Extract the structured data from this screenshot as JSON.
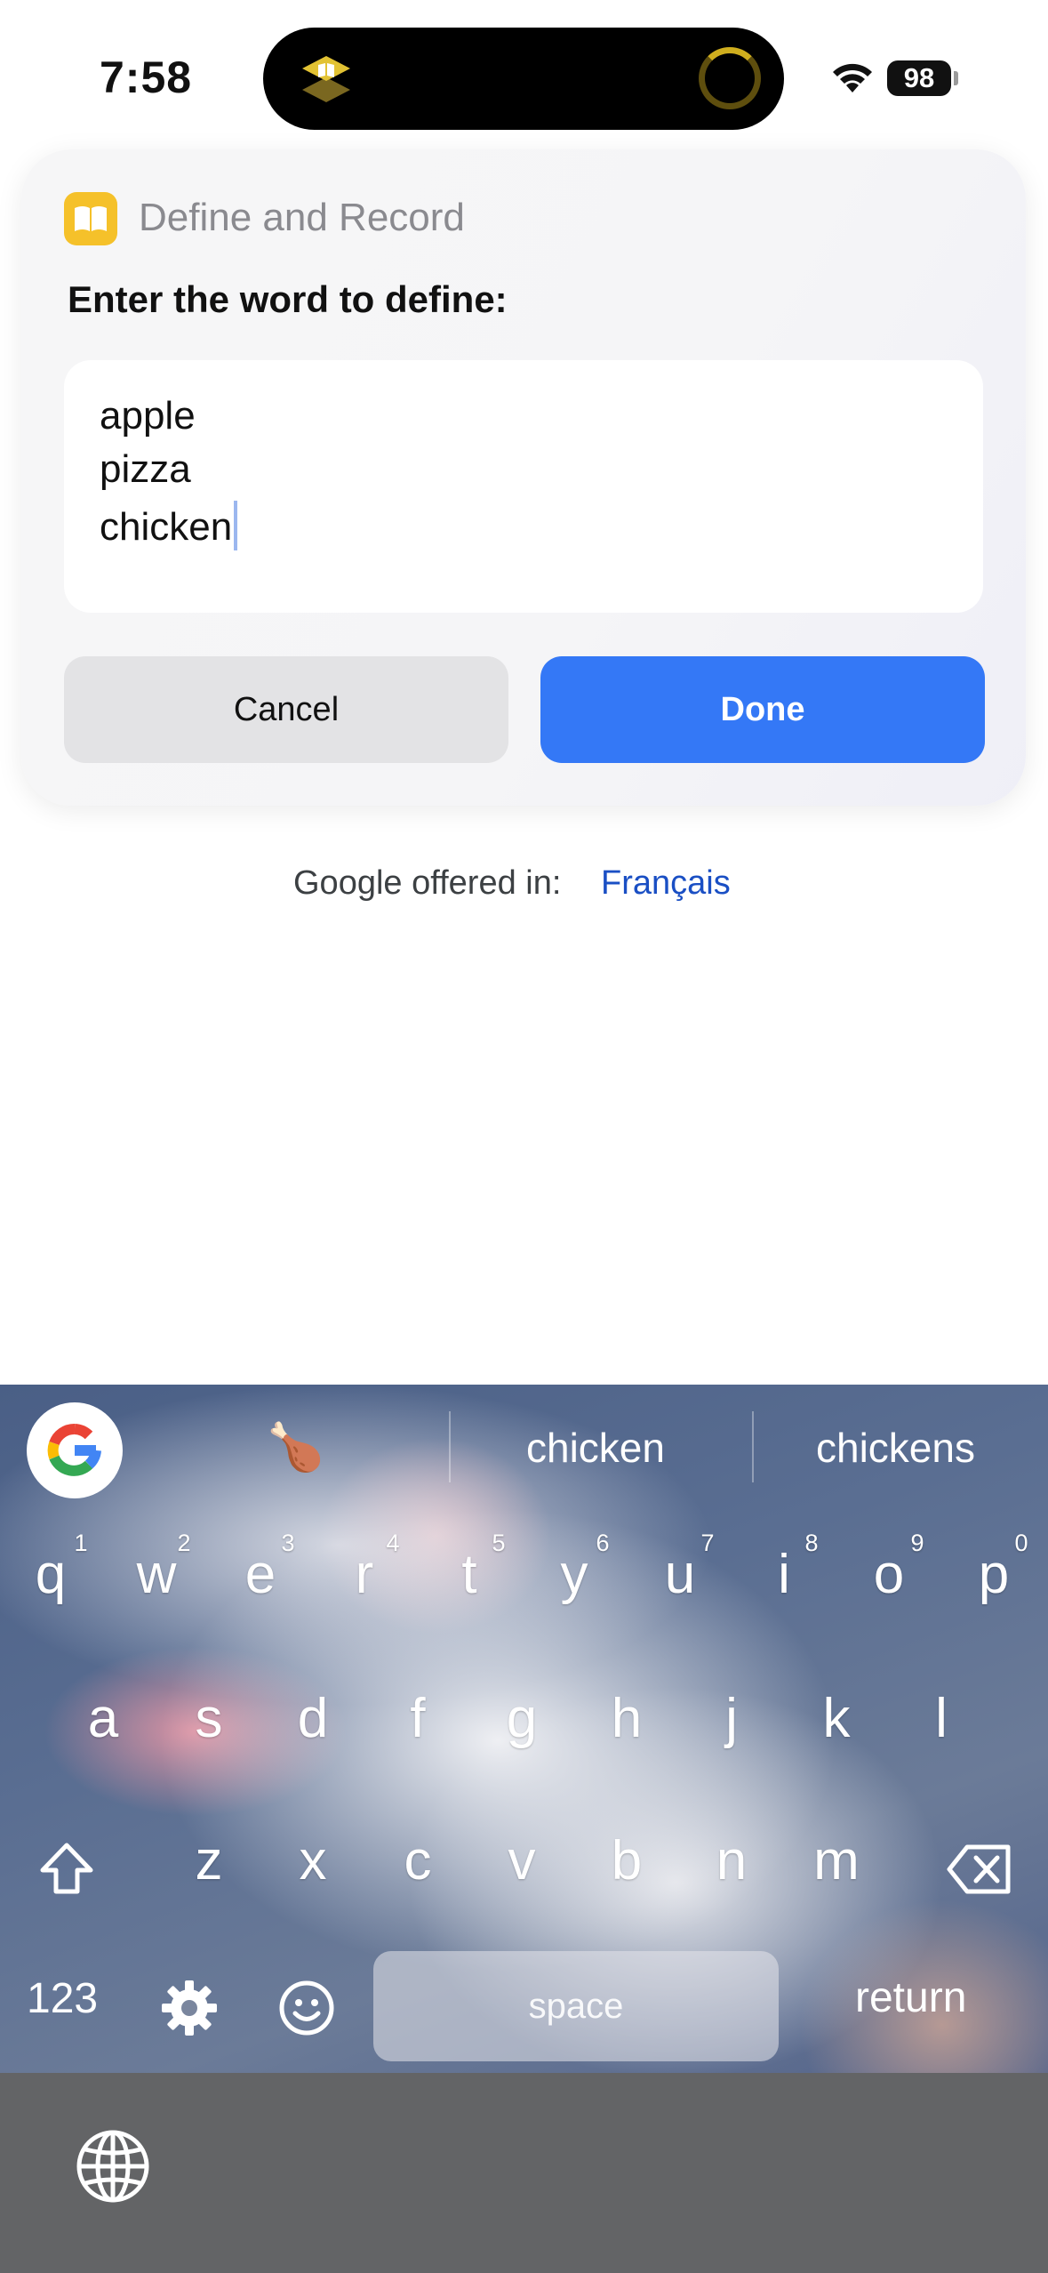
{
  "status": {
    "time": "7:58",
    "battery": "98"
  },
  "dialog": {
    "app_name": "Define and Record",
    "prompt": "Enter the word to define:",
    "input_lines": [
      "apple",
      "pizza",
      "chicken"
    ],
    "cancel_label": "Cancel",
    "done_label": "Done"
  },
  "page": {
    "offered_text": "Google offered in:",
    "offered_language": "Français"
  },
  "keyboard": {
    "emoji_suggestion": "🍗",
    "suggestions": [
      "chicken",
      "chickens"
    ],
    "row1": [
      "q",
      "w",
      "e",
      "r",
      "t",
      "y",
      "u",
      "i",
      "o",
      "p"
    ],
    "row1_hints": [
      "1",
      "2",
      "3",
      "4",
      "5",
      "6",
      "7",
      "8",
      "9",
      "0"
    ],
    "row2": [
      "a",
      "s",
      "d",
      "f",
      "g",
      "h",
      "j",
      "k",
      "l"
    ],
    "row3": [
      "z",
      "x",
      "c",
      "v",
      "b",
      "n",
      "m"
    ],
    "numbers_label": "123",
    "space_label": "space",
    "return_label": "return"
  },
  "icons": {
    "status": [
      "wifi-icon",
      "battery-icon"
    ],
    "dialog": [
      "book-icon"
    ],
    "keyboard": [
      "google-logo-icon",
      "shift-icon",
      "backspace-icon",
      "gear-icon",
      "emoji-icon",
      "globe-icon"
    ]
  },
  "colors": {
    "accent": "#3478f6",
    "link": "#1a4fc4"
  }
}
